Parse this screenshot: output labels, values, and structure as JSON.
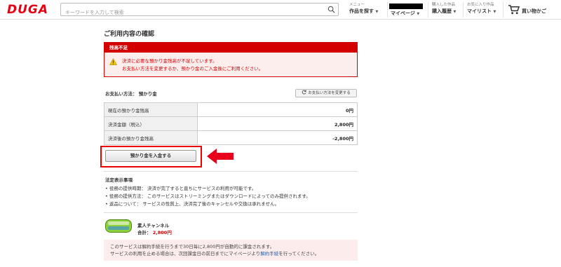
{
  "header": {
    "logo": "DUGA",
    "search_placeholder": "キーワードを入力して検索",
    "nav": [
      {
        "small": "メニュー",
        "label": "作品を探す"
      },
      {
        "small": "",
        "label": "マイページ"
      },
      {
        "small": "購入した作品",
        "label": "購入履歴"
      },
      {
        "small": "お気に入り作品",
        "label": "マイリスト"
      },
      {
        "small": "",
        "label": "買い物かご"
      }
    ]
  },
  "page": {
    "title": "ご利用内容の確認",
    "error": {
      "heading": "残高不足",
      "line1": "決済に必要な預かり金残高が不足しています。",
      "line2": "お支払い方法を変更するか、預かり金のご入金後にご利用ください。"
    },
    "payment_method_label": "お支払い方法： 預かり金",
    "change_method_button": "お支払い方法を変更する",
    "rows": [
      {
        "label": "現在の預かり金残高",
        "value": "0円"
      },
      {
        "label": "決済金額（税込）",
        "value": "2,800円"
      },
      {
        "label": "決済後の預かり金残高",
        "value": "-2,800円"
      }
    ],
    "deposit_button": "預かり金を入金する",
    "legal": {
      "title": "法定表示事項",
      "items": [
        "役務の提供時期： 決済が完了すると直ちにサービスの利用が可能です。",
        "役務の提供方法： このサービスはストリーミングまたはダウンロードによってのみ提供されます。",
        "返品について： サービスの性質上、決済完了後のキャンセルや交換は承れません。"
      ]
    },
    "product": {
      "name": "素人チャンネル",
      "total_label": "合計：",
      "total_price": "2,800円"
    },
    "notice": {
      "line1": "このサービスは解約手続を行うまで30日毎に2,800円が自動的に課金されます。",
      "line2_pre": "サービスの利用を止める場合は、次回課金日の前日までにマイページより",
      "line2_link": "解約手続",
      "line2_post": "を行ってください。"
    }
  },
  "colors": {
    "brand": "#e60012",
    "error": "#d40000",
    "link": "#1a5fb4"
  }
}
